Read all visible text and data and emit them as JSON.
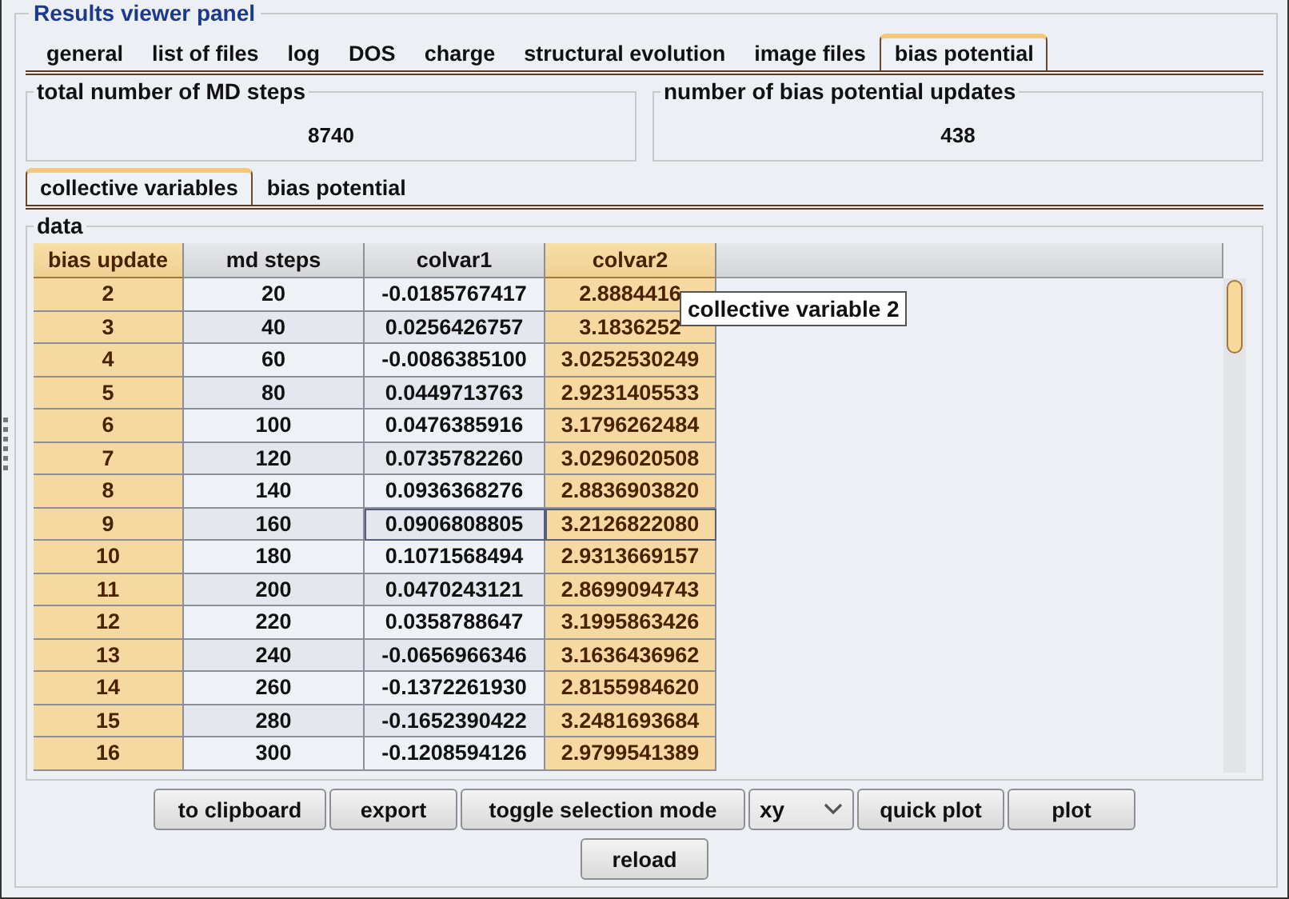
{
  "panel": {
    "title": "Results viewer panel"
  },
  "tabs": [
    {
      "label": "general",
      "selected": false
    },
    {
      "label": "list of files",
      "selected": false
    },
    {
      "label": "log",
      "selected": false
    },
    {
      "label": "DOS",
      "selected": false
    },
    {
      "label": "charge",
      "selected": false
    },
    {
      "label": "structural evolution",
      "selected": false
    },
    {
      "label": "image files",
      "selected": false
    },
    {
      "label": "bias potential",
      "selected": true
    }
  ],
  "summary": [
    {
      "title": "total number of MD steps",
      "value": "8740"
    },
    {
      "title": "number of bias potential updates",
      "value": "438"
    }
  ],
  "subtabs": [
    {
      "label": "collective variables",
      "selected": true
    },
    {
      "label": "bias potential",
      "selected": false
    }
  ],
  "data": {
    "title": "data",
    "columns": [
      {
        "label": "bias update",
        "selected": true
      },
      {
        "label": "md steps",
        "selected": false
      },
      {
        "label": "colvar1",
        "selected": false
      },
      {
        "label": "colvar2",
        "selected": true
      }
    ],
    "rows": [
      {
        "cells": [
          "2",
          "20",
          "-0.0185767417",
          "2.8884416"
        ],
        "selected": false
      },
      {
        "cells": [
          "3",
          "40",
          "0.0256426757",
          "3.1836252"
        ],
        "selected": false
      },
      {
        "cells": [
          "4",
          "60",
          "-0.0086385100",
          "3.0252530249"
        ],
        "selected": false
      },
      {
        "cells": [
          "5",
          "80",
          "0.0449713763",
          "2.9231405533"
        ],
        "selected": false
      },
      {
        "cells": [
          "6",
          "100",
          "0.0476385916",
          "3.1796262484"
        ],
        "selected": false
      },
      {
        "cells": [
          "7",
          "120",
          "0.0735782260",
          "3.0296020508"
        ],
        "selected": false
      },
      {
        "cells": [
          "8",
          "140",
          "0.0936368276",
          "2.8836903820"
        ],
        "selected": false
      },
      {
        "cells": [
          "9",
          "160",
          "0.0906808805",
          "3.2126822080"
        ],
        "selected": true
      },
      {
        "cells": [
          "10",
          "180",
          "0.1071568494",
          "2.9313669157"
        ],
        "selected": false
      },
      {
        "cells": [
          "11",
          "200",
          "0.0470243121",
          "2.8699094743"
        ],
        "selected": false
      },
      {
        "cells": [
          "12",
          "220",
          "0.0358788647",
          "3.1995863426"
        ],
        "selected": false
      },
      {
        "cells": [
          "13",
          "240",
          "-0.0656966346",
          "3.1636436962"
        ],
        "selected": false
      },
      {
        "cells": [
          "14",
          "260",
          "-0.1372261930",
          "2.8155984620"
        ],
        "selected": false
      },
      {
        "cells": [
          "15",
          "280",
          "-0.1652390422",
          "3.2481693684"
        ],
        "selected": false
      },
      {
        "cells": [
          "16",
          "300",
          "-0.1208594126",
          "2.9799541389"
        ],
        "selected": false
      }
    ],
    "tooltip": "collective variable 2"
  },
  "buttons": [
    {
      "kind": "button",
      "label": "to clipboard"
    },
    {
      "kind": "button",
      "label": "export"
    },
    {
      "kind": "button",
      "label": "toggle selection mode"
    },
    {
      "kind": "select",
      "label": "xy"
    },
    {
      "kind": "button",
      "label": "quick plot"
    },
    {
      "kind": "button",
      "label": "plot"
    }
  ],
  "bottom_buttons": [
    {
      "kind": "button",
      "label": "reload"
    }
  ]
}
